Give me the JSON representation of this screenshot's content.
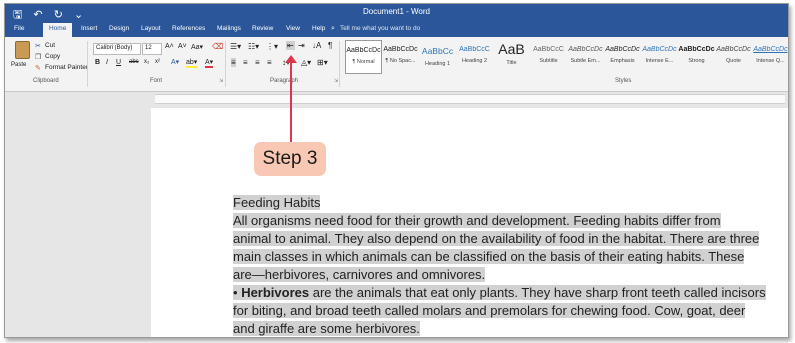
{
  "window": {
    "title": "Document1 - Word",
    "quick_access": "🖫 ↶ ↻ ⌄"
  },
  "tabs": [
    "File",
    "Home",
    "Insert",
    "Design",
    "Layout",
    "References",
    "Mailings",
    "Review",
    "View",
    "Help"
  ],
  "tell_me": "Tell me what you want to do",
  "clipboard": {
    "paste": "Paste",
    "cut": "Cut",
    "copy": "Copy",
    "format_painter": "Format Painter",
    "label": "Clipboard"
  },
  "font": {
    "name": "Calibri (Body)",
    "size": "12",
    "label": "Font",
    "bold": "B",
    "italic": "I",
    "underline": "U"
  },
  "paragraph": {
    "label": "Paragraph"
  },
  "styles": {
    "label": "Styles",
    "items": [
      {
        "preview": "AaBbCcDc",
        "name": "¶ Normal"
      },
      {
        "preview": "AaBbCcDc",
        "name": "¶ No Spac..."
      },
      {
        "preview": "AaBbCc",
        "name": "Heading 1"
      },
      {
        "preview": "AaBbCcC",
        "name": "Heading 2"
      },
      {
        "preview": "AaB",
        "name": "Title"
      },
      {
        "preview": "AaBbCcC",
        "name": "Subtitle"
      },
      {
        "preview": "AaBbCcDc",
        "name": "Subtle Em..."
      },
      {
        "preview": "AaBbCcDc",
        "name": "Emphasis"
      },
      {
        "preview": "AaBbCcDc",
        "name": "Intense E..."
      },
      {
        "preview": "AaBbCcDc",
        "name": "Strong"
      },
      {
        "preview": "AaBbCcDc",
        "name": "Quote"
      },
      {
        "preview": "AaBbCcDc",
        "name": "Intense Q..."
      }
    ]
  },
  "callout": {
    "text": "Step 3"
  },
  "document": {
    "heading": "Feeding Habits",
    "p1": [
      "All organisms need food for their growth and development. Feeding habits differ from",
      "animal to animal. They also depend on the availability of food in the habitat. There are three",
      "main classes in which animals can be classified on the basis of their eating habits. These",
      "are—herbivores, carnivores and omnivores."
    ],
    "bullet": "•",
    "herb_term": "Herbivores",
    "herb_lines": [
      " are the animals that eat only plants. They have sharp front teeth called incisors",
      "for biting, and broad teeth called molars and premolars for chewing food. Cow, goat, deer",
      "and giraffe are some herbivores."
    ]
  },
  "colors": {
    "accent": "#2b579a",
    "callout": "#f8c8b4",
    "arrow": "#e0344a",
    "highlight": "#d1d1d1"
  }
}
